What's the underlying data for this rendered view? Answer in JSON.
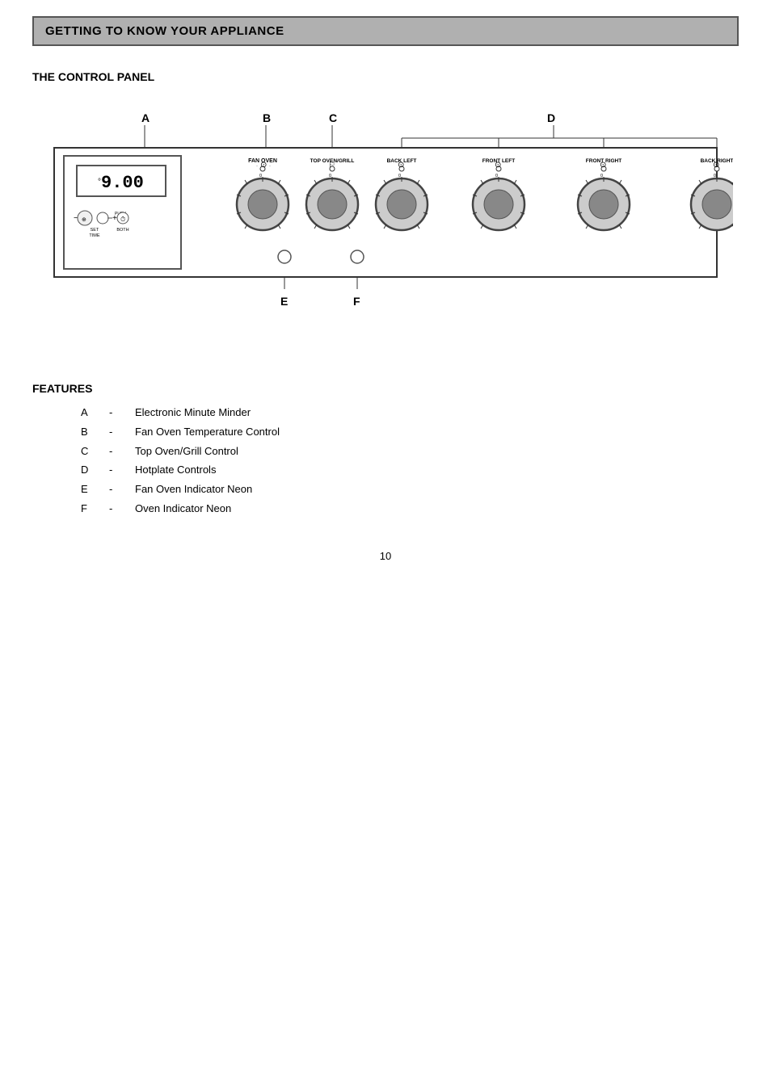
{
  "header": {
    "title": "GETTING TO KNOW YOUR APPLIANCE"
  },
  "control_panel_section": {
    "title": "THE CONTROL PANEL"
  },
  "diagram": {
    "labels": {
      "A": "A",
      "B": "B",
      "C": "C",
      "D": "D",
      "E": "E",
      "F": "F"
    },
    "knobs": [
      {
        "id": "fan-oven",
        "label": "FAN OVEN",
        "type": "fan"
      },
      {
        "id": "top-oven-grill",
        "label": "TOP OVEN/GRILL",
        "type": "pot"
      },
      {
        "id": "back-left",
        "label": "BACK LEFT",
        "type": "hotplate"
      },
      {
        "id": "front-left",
        "label": "FRONT LEFT",
        "type": "hotplate"
      },
      {
        "id": "front-right",
        "label": "FRONT RIGHT",
        "type": "hotplate"
      },
      {
        "id": "back-right",
        "label": "BACK RIGHT",
        "type": "hotplate"
      }
    ],
    "timer_display": "9.00",
    "neon_e_label": "E",
    "neon_f_label": "F"
  },
  "features": {
    "title": "FEATURES",
    "items": [
      {
        "letter": "A",
        "dash": "-",
        "description": "Electronic Minute Minder"
      },
      {
        "letter": "B",
        "dash": "-",
        "description": "Fan Oven Temperature Control"
      },
      {
        "letter": "C",
        "dash": "-",
        "description": "Top Oven/Grill Control"
      },
      {
        "letter": "D",
        "dash": "-",
        "description": "Hotplate Controls"
      },
      {
        "letter": "E",
        "dash": "-",
        "description": "Fan Oven Indicator Neon"
      },
      {
        "letter": "F",
        "dash": "-",
        "description": "Oven Indicator Neon"
      }
    ]
  },
  "page_number": "10"
}
